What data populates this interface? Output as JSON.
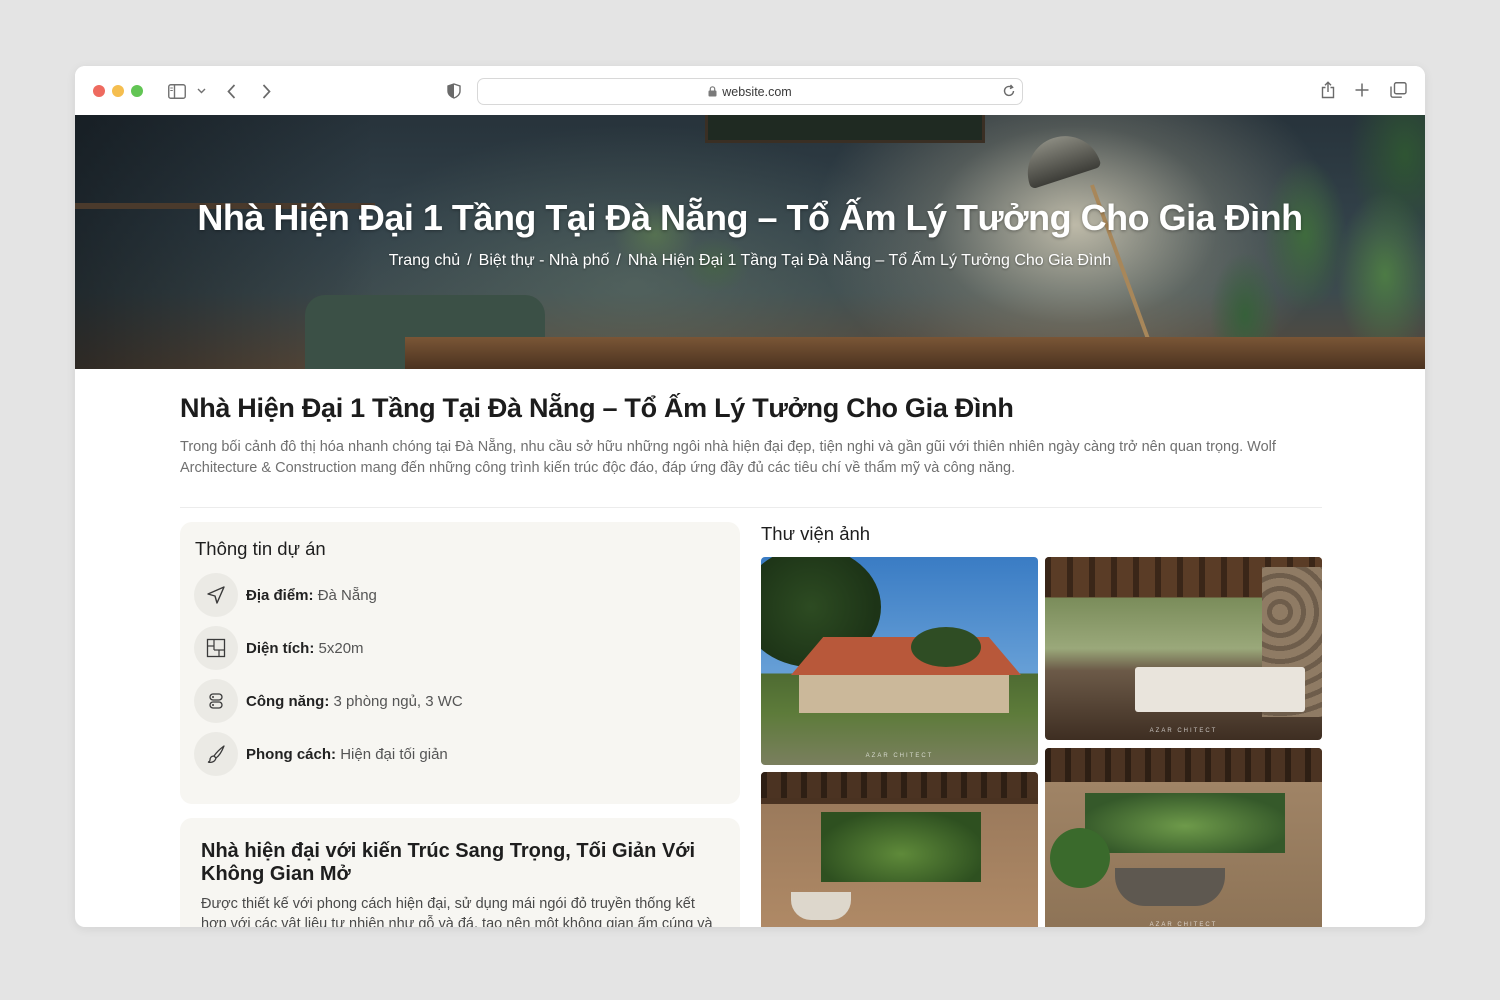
{
  "browser": {
    "url": "website.com",
    "icons": {
      "sidebar": "sidebar-icon",
      "back": "chevron-left-icon",
      "forward": "chevron-right-icon",
      "privacy": "shield-icon",
      "lock": "lock-icon",
      "reload": "reload-icon",
      "share": "share-icon",
      "new_tab": "plus-icon",
      "tabs": "tabs-icon"
    }
  },
  "hero": {
    "title": "Nhà Hiện Đại 1 Tầng Tại Đà Nẵng – Tổ Ấm Lý Tưởng Cho Gia Đình",
    "breadcrumb": [
      "Trang chủ",
      "Biệt thự - Nhà phố",
      "Nhà Hiện Đại 1 Tầng Tại Đà Nẵng – Tổ Ấm Lý Tưởng Cho Gia Đình"
    ],
    "separator": "/"
  },
  "article": {
    "title": "Nhà Hiện Đại 1 Tầng Tại Đà Nẵng – Tổ Ấm Lý Tưởng Cho Gia Đình",
    "intro": "Trong bối cảnh đô thị hóa nhanh chóng tại Đà Nẵng, nhu cầu sở hữu những ngôi nhà hiện đại đẹp, tiện nghi và gần gũi với thiên nhiên ngày càng trở nên quan trọng. Wolf Architecture & Construction mang đến những công trình kiến trúc độc đáo, đáp ứng đầy đủ các tiêu chí về thẩm mỹ và công năng."
  },
  "project_info": {
    "title": "Thông tin dự án",
    "items": [
      {
        "label": "Địa điểm:",
        "value": "Đà Nẵng",
        "icon": "location-arrow-icon"
      },
      {
        "label": "Diện tích:",
        "value": "5x20m",
        "icon": "floor-plan-icon"
      },
      {
        "label": "Công năng:",
        "value": "3 phòng ngủ, 3 WC",
        "icon": "rooms-icon"
      },
      {
        "label": "Phong cách:",
        "value": "Hiện đại tối giản",
        "icon": "brush-icon"
      }
    ]
  },
  "description": {
    "heading": "Nhà hiện đại với kiến Trúc Sang Trọng, Tối Giản Với Không Gian Mở",
    "body": "Được thiết kế với phong cách hiện đại, sử dụng mái ngói đỏ truyền thống kết hợp với các vật liệu tự nhiên như gỗ và đá, tạo nên một không gian ấm cúng và"
  },
  "gallery": {
    "title": "Thư viện ảnh",
    "watermark": "AZAR CHITECT"
  }
}
